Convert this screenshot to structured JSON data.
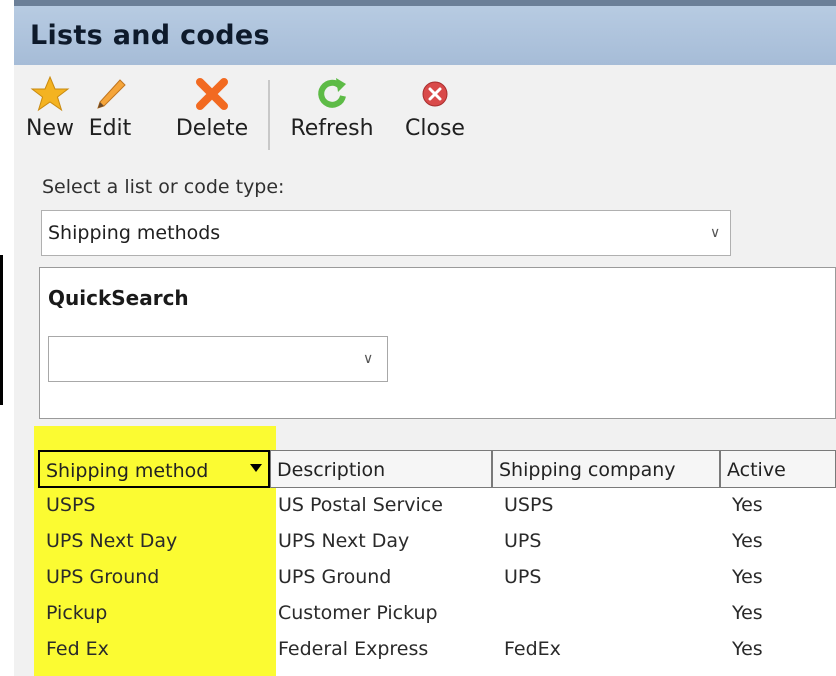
{
  "window": {
    "title": "Lists and codes"
  },
  "toolbar": {
    "buttons": [
      {
        "label": "New",
        "icon": "star-icon"
      },
      {
        "label": "Edit",
        "icon": "pencil-icon"
      },
      {
        "label": "Delete",
        "icon": "x-icon"
      },
      {
        "label": "Refresh",
        "icon": "refresh-icon"
      },
      {
        "label": "Close",
        "icon": "close-circle-icon"
      }
    ]
  },
  "list_type": {
    "label": "Select a list or code type:",
    "value": "Shipping methods"
  },
  "quicksearch": {
    "title": "QuickSearch",
    "value": ""
  },
  "grid": {
    "columns": [
      "Shipping method",
      "Description",
      "Shipping company",
      "Active"
    ],
    "rows": [
      [
        "USPS",
        "US Postal Service",
        "USPS",
        "Yes"
      ],
      [
        "UPS Next Day",
        "UPS Next Day",
        "UPS",
        "Yes"
      ],
      [
        "UPS Ground",
        "UPS Ground",
        "UPS",
        "Yes"
      ],
      [
        "Pickup",
        "Customer Pickup",
        "",
        "Yes"
      ],
      [
        "Fed Ex",
        "Federal Express",
        "FedEx",
        "Yes"
      ]
    ]
  },
  "colors": {
    "titlebar": "#a9bfd9",
    "highlight": "#fbfb32",
    "star": "#f4b321",
    "pencil": "#f5a53a",
    "delete": "#f26a21",
    "refresh": "#5dbb46",
    "close": "#d94a4a"
  }
}
